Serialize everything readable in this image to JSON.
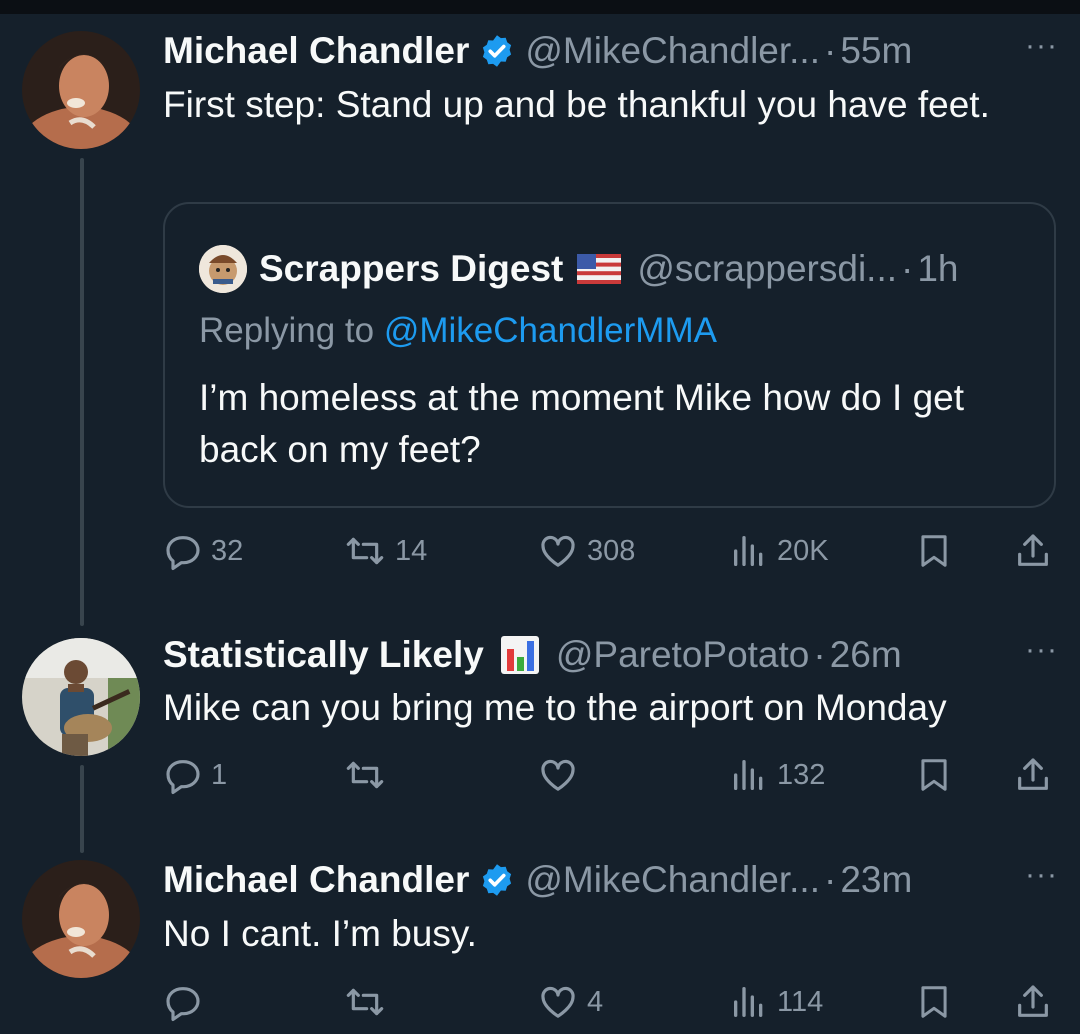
{
  "tweets": [
    {
      "author": "Michael Chandler",
      "handle": "@MikeChandler...",
      "time": "55m",
      "text": "First step: Stand up and be thankful you have feet.",
      "quote": {
        "author": "Scrappers Digest",
        "handle": "@scrappersdi...",
        "time": "1h",
        "replying_prefix": "Replying to",
        "replying_to": "@MikeChandlerMMA",
        "text": "I’m homeless at the moment Mike how do I get back on my feet?"
      },
      "actions": {
        "replies": "32",
        "retweets": "14",
        "likes": "308",
        "views": "20K"
      }
    },
    {
      "author": "Statistically Likely",
      "handle": "@ParetoPotato",
      "time": "26m",
      "text": "Mike can you bring me to the airport on Monday",
      "actions": {
        "replies": "1",
        "retweets": "",
        "likes": "",
        "views": "132"
      }
    },
    {
      "author": "Michael Chandler",
      "handle": "@MikeChandler...",
      "time": "23m",
      "text": "No I cant. I’m busy.",
      "actions": {
        "replies": "",
        "retweets": "",
        "likes": "4",
        "views": "114"
      }
    }
  ],
  "ui": {
    "separator": "·",
    "more": "···"
  },
  "colors": {
    "background": "#15202b",
    "text": "#f7f9f9",
    "secondary": "#8b98a5",
    "accent": "#1d9bf0",
    "thread_line": "#38444d"
  },
  "icons": [
    "verified-badge-icon",
    "us-flag-icon",
    "bar-chart-emoji-icon",
    "reply-icon",
    "retweet-icon",
    "like-icon",
    "views-icon",
    "bookmark-icon",
    "share-icon",
    "more-icon"
  ]
}
